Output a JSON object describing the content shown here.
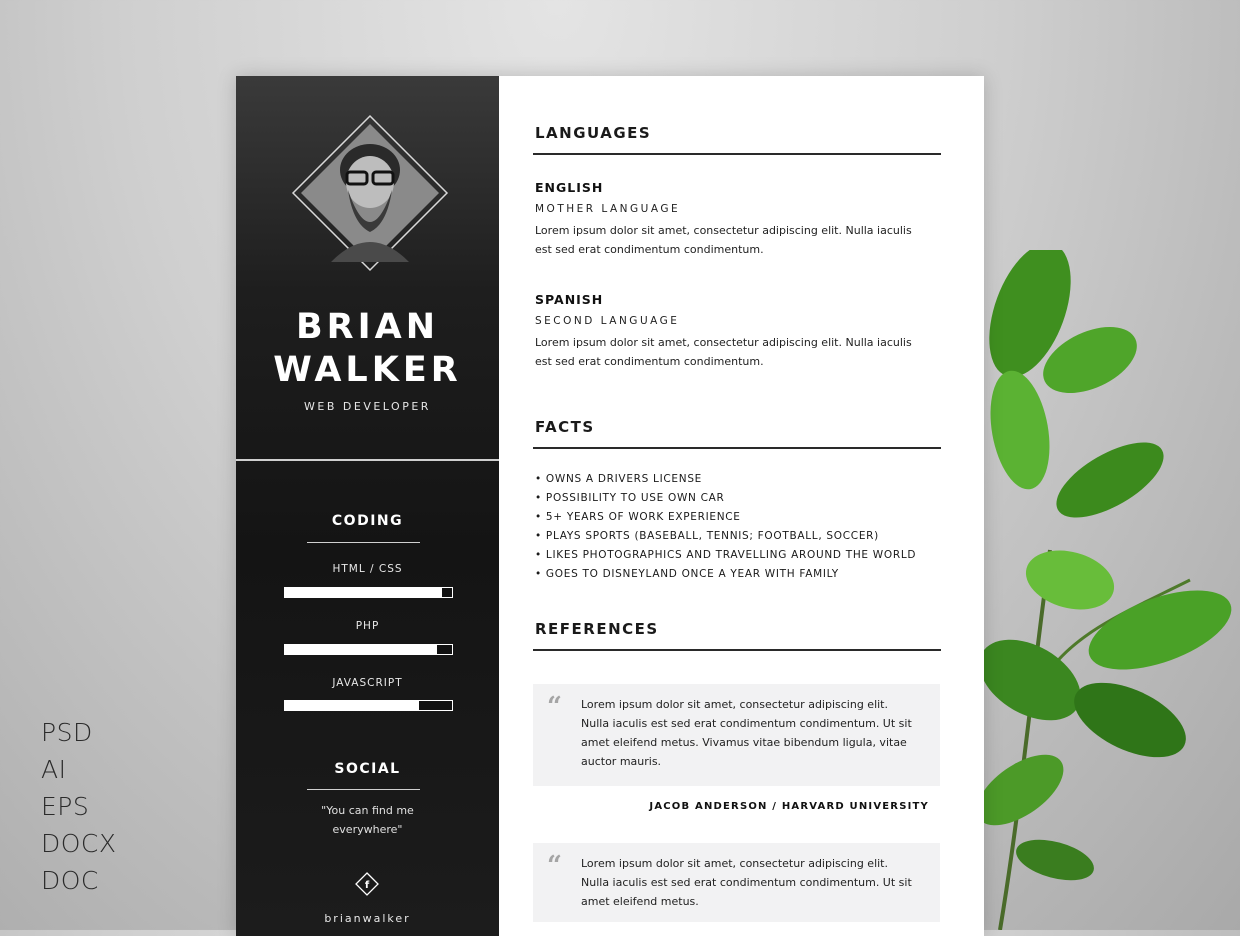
{
  "formats": [
    "PSD",
    "AI",
    "EPS",
    "DOCX",
    "DOC"
  ],
  "profile": {
    "first_name": "BRIAN",
    "last_name": "WALKER",
    "title": "WEB DEVELOPER"
  },
  "coding": {
    "heading": "CODING",
    "skills": [
      {
        "label": "HTML / CSS",
        "level": 0.94
      },
      {
        "label": "PHP",
        "level": 0.91
      },
      {
        "label": "JAVASCRIPT",
        "level": 0.8
      }
    ]
  },
  "social": {
    "heading": "SOCIAL",
    "quote": "\"You can find me everywhere\"",
    "icon": "facebook-icon",
    "handle": "brianwalker"
  },
  "languages": {
    "heading": "LANGUAGES",
    "items": [
      {
        "name": "ENGLISH",
        "level": "MOTHER LANGUAGE",
        "description": "Lorem ipsum dolor sit amet, consectetur adipiscing elit. Nulla iaculis est sed erat condimentum condimentum."
      },
      {
        "name": "SPANISH",
        "level": "SECOND LANGUAGE",
        "description": "Lorem ipsum dolor sit amet, consectetur adipiscing elit. Nulla iaculis est sed erat condimentum condimentum."
      }
    ]
  },
  "facts": {
    "heading": "FACTS",
    "items": [
      "• OWNS A DRIVERS LICENSE",
      "• POSSIBILITY TO USE OWN CAR",
      "• 5+ YEARS OF WORK EXPERIENCE",
      "• PLAYS SPORTS (BASEBALL, TENNIS; FOOTBALL, SOCCER)",
      "• LIKES PHOTOGRAPHICS AND TRAVELLING AROUND THE WORLD",
      "• GOES TO DISNEYLAND ONCE A YEAR WITH FAMILY"
    ]
  },
  "references": {
    "heading": "REFERENCES",
    "quote_mark": "“",
    "items": [
      {
        "text": "Lorem ipsum dolor sit amet, consectetur adipiscing elit. Nulla iaculis est sed erat condimentum condimentum. Ut sit amet eleifend metus. Vivamus vitae bibendum ligula, vitae auctor mauris.",
        "author": "JACOB ANDERSON / HARVARD UNIVERSITY"
      },
      {
        "text": "Lorem ipsum dolor sit amet, consectetur adipiscing elit. Nulla iaculis est sed erat condimentum condimentum. Ut sit amet eleifend metus."
      }
    ]
  }
}
